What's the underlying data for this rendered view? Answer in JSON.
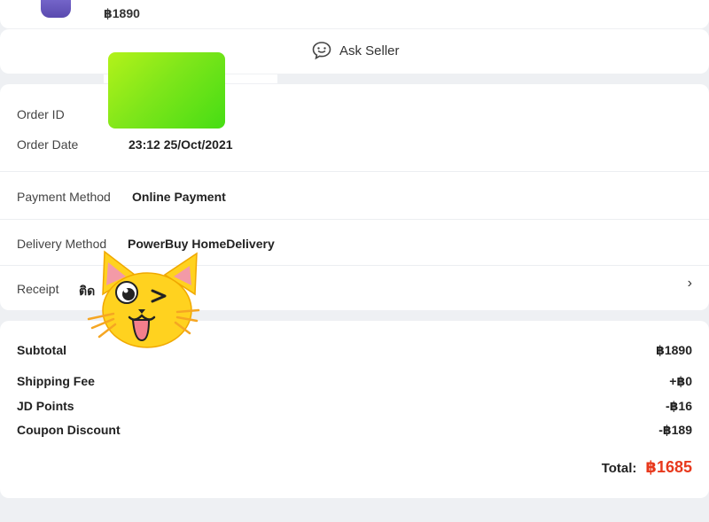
{
  "product": {
    "price": "฿1890"
  },
  "ask_seller": {
    "label": "Ask Seller",
    "icon": "chat-smile-icon"
  },
  "order": {
    "order_id_label": "Order ID",
    "order_date_label": "Order Date",
    "order_date_value": "23:12 25/Oct/2021",
    "payment_label": "Payment Method",
    "payment_value": "Online Payment",
    "delivery_label": "Delivery Method",
    "delivery_value": "PowerBuy HomeDelivery",
    "receipt_label": "Receipt",
    "receipt_value": "ติด",
    "chevron": "›"
  },
  "summary": {
    "subtotal_label": "Subtotal",
    "subtotal_value": "฿1890",
    "shipping_label": "Shipping Fee",
    "shipping_value": "+฿0",
    "points_label": "JD Points",
    "points_value": "-฿16",
    "coupon_label": "Coupon Discount",
    "coupon_value": "-฿189",
    "total_label": "Total:",
    "total_value": "฿1685"
  },
  "colors": {
    "accent": "#e8391d",
    "background": "#eef0f3",
    "censor_green": "#7fe61a",
    "sticker_yellow": "#ffd21f"
  }
}
